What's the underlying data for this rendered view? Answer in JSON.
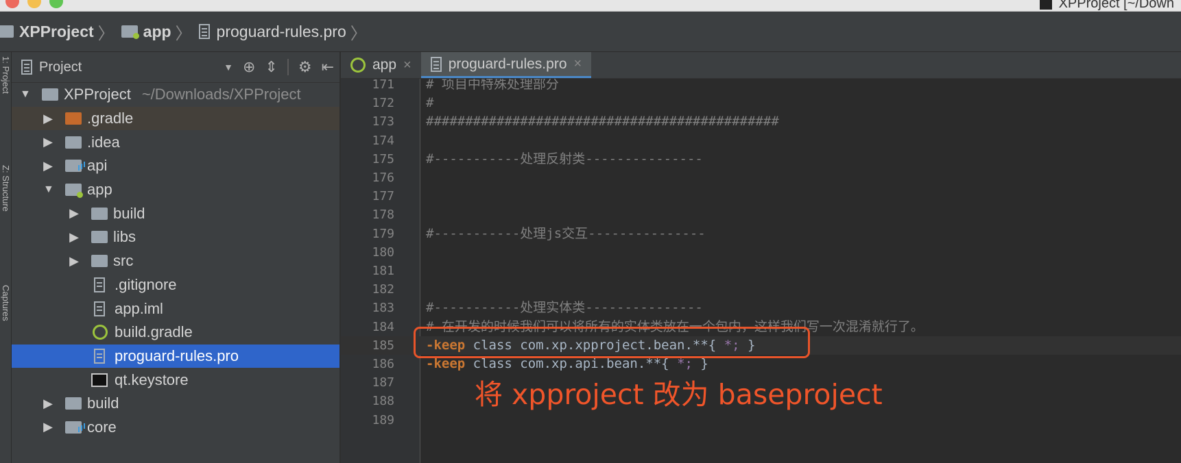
{
  "window": {
    "title": "XPProject [~/Down",
    "traffic_colors": [
      "#ec6a5e",
      "#f4bf4f",
      "#61c554"
    ]
  },
  "breadcrumb": {
    "items": [
      {
        "label": "XPProject",
        "icon": "project-folder-icon"
      },
      {
        "label": "app",
        "icon": "module-folder-icon"
      },
      {
        "label": "proguard-rules.pro",
        "icon": "text-file-icon"
      }
    ],
    "separator": "〉"
  },
  "left_strip": {
    "labels": [
      "1: Project",
      "Z: Structure",
      "Captures"
    ]
  },
  "project_panel": {
    "title": "Project",
    "tools": [
      "dropdown-icon",
      "target-icon",
      "collapse-icon",
      "gear-icon",
      "hide-icon"
    ],
    "tree": [
      {
        "label": "XPProject",
        "hint": "~/Downloads/XPProject",
        "depth": 0,
        "arrow": "▼",
        "icon": "project-folder"
      },
      {
        "label": ".gradle",
        "depth": 1,
        "arrow": "▶",
        "icon": "orange-folder"
      },
      {
        "label": ".idea",
        "depth": 1,
        "arrow": "▶",
        "icon": "folder"
      },
      {
        "label": "api",
        "depth": 1,
        "arrow": "▶",
        "icon": "library-folder"
      },
      {
        "label": "app",
        "depth": 1,
        "arrow": "▼",
        "icon": "module-folder"
      },
      {
        "label": "build",
        "depth": 2,
        "arrow": "▶",
        "icon": "folder"
      },
      {
        "label": "libs",
        "depth": 2,
        "arrow": "▶",
        "icon": "folder"
      },
      {
        "label": "src",
        "depth": 2,
        "arrow": "▶",
        "icon": "folder"
      },
      {
        "label": ".gitignore",
        "depth": 2,
        "arrow": "",
        "icon": "text-file"
      },
      {
        "label": "app.iml",
        "depth": 2,
        "arrow": "",
        "icon": "text-file"
      },
      {
        "label": "build.gradle",
        "depth": 2,
        "arrow": "",
        "icon": "gradle-file"
      },
      {
        "label": "proguard-rules.pro",
        "depth": 2,
        "arrow": "",
        "icon": "text-file",
        "selected": true
      },
      {
        "label": "qt.keystore",
        "depth": 2,
        "arrow": "",
        "icon": "keystore-file"
      },
      {
        "label": "build",
        "depth": 1,
        "arrow": "▶",
        "icon": "folder"
      },
      {
        "label": "core",
        "depth": 1,
        "arrow": "▶",
        "icon": "library-folder"
      }
    ]
  },
  "tabs": [
    {
      "label": "app",
      "close": "×",
      "active": false
    },
    {
      "label": "proguard-rules.pro",
      "close": "×",
      "active": true
    }
  ],
  "code": {
    "lines": [
      {
        "num": "171",
        "text": "# 项目中特殊处理部分"
      },
      {
        "num": "172",
        "text": "#"
      },
      {
        "num": "173",
        "text": "#############################################"
      },
      {
        "num": "174",
        "text": ""
      },
      {
        "num": "175",
        "text": "#-----------处理反射类---------------"
      },
      {
        "num": "176",
        "text": ""
      },
      {
        "num": "177",
        "text": ""
      },
      {
        "num": "178",
        "text": ""
      },
      {
        "num": "179",
        "text": "#-----------处理js交互---------------"
      },
      {
        "num": "180",
        "text": ""
      },
      {
        "num": "181",
        "text": ""
      },
      {
        "num": "182",
        "text": ""
      },
      {
        "num": "183",
        "text": "#-----------处理实体类---------------"
      },
      {
        "num": "184",
        "text": "# 在开发的时候我们可以将所有的实体类放在一个包内，这样我们写一次混淆就行了。"
      },
      {
        "num": "185",
        "keyword": "-keep",
        "plain": " class com.xp.xpproject.bean.**{ ",
        "purple": "*;",
        "end": " }",
        "current": true
      },
      {
        "num": "186",
        "keyword": "-keep",
        "plain": " class com.xp.api.bean.**{ ",
        "purple": "*;",
        "end": " }"
      },
      {
        "num": "187",
        "text": ""
      },
      {
        "num": "188",
        "text": ""
      },
      {
        "num": "189",
        "text": ""
      }
    ]
  },
  "annotation": {
    "text": "将 xpproject 改为 baseproject",
    "color": "#f0552a"
  }
}
